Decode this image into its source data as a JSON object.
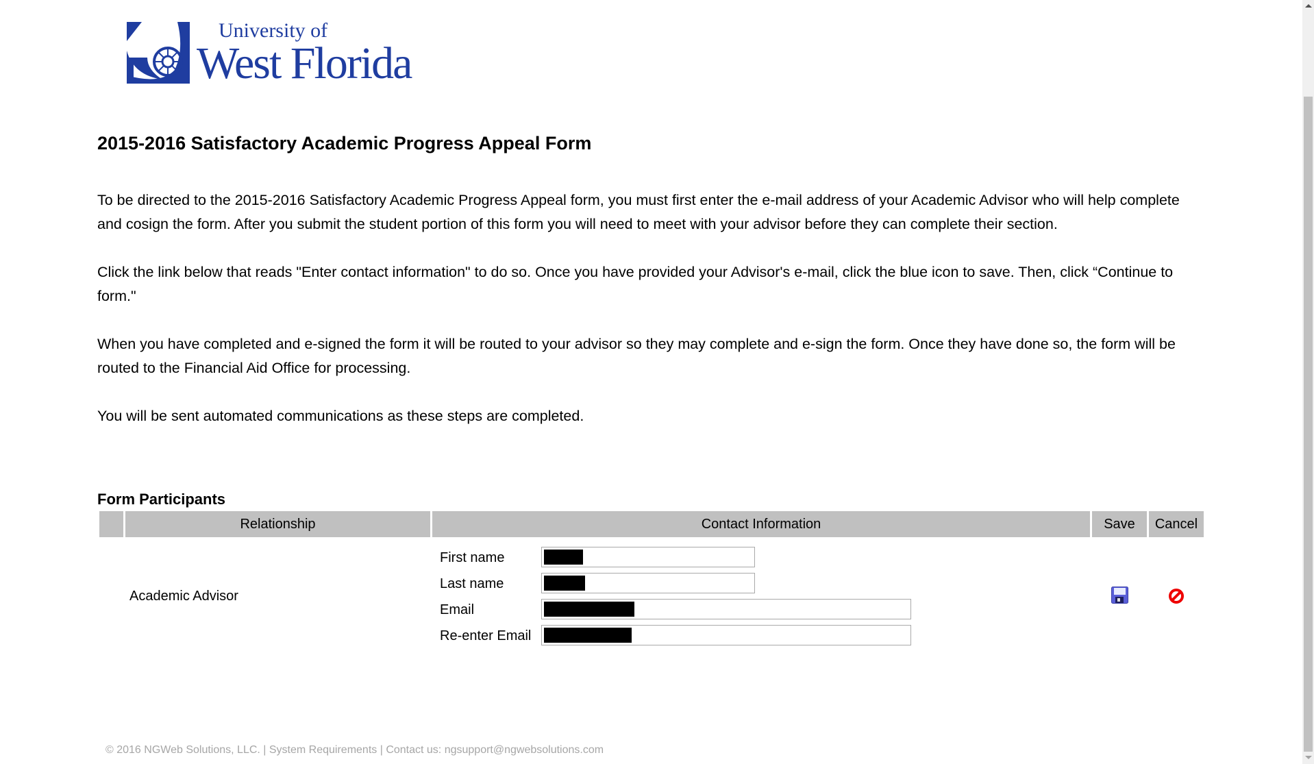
{
  "logo": {
    "line1": "University of",
    "line2": "West Florida",
    "color": "#1f3da0"
  },
  "page": {
    "title": "2015-2016 Satisfactory Academic Progress Appeal Form",
    "paragraphs": [
      "To be directed to the 2015-2016 Satisfactory Academic Progress Appeal form, you must first enter the e-mail address of your Academic Advisor who will help complete and cosign the form. After you submit the student portion of this form you will need to meet with your advisor before they can complete their section.",
      "Click the link below that reads \"Enter contact information\" to do so. Once you have provided your Advisor's e-mail, click the blue icon to save. Then, click “Continue to form.\"",
      "When you have completed and e-signed the form it will be routed to your advisor so they may complete and e-sign the form. Once they have done so, the form will be routed to the Financial Aid Office for processing.",
      "You will be sent automated communications as these steps are completed."
    ]
  },
  "participants": {
    "title": "Form Participants",
    "columns": [
      "",
      "Relationship",
      "Contact Information",
      "Save",
      "Cancel"
    ],
    "rows": [
      {
        "relationship": "Academic Advisor",
        "fields": [
          {
            "label": "First name",
            "value": "[redacted]"
          },
          {
            "label": "Last name",
            "value": "[redacted]"
          },
          {
            "label": "Email",
            "value": "[redacted]"
          },
          {
            "label": "Re-enter Email",
            "value": "[redacted]"
          }
        ],
        "save_icon": "floppy-disk-icon",
        "cancel_icon": "cancel-circle-slash-icon"
      }
    ]
  },
  "footer": {
    "text": "© 2016 NGWeb Solutions, LLC. | System Requirements | Contact us: ngsupport@ngwebsolutions.com"
  }
}
